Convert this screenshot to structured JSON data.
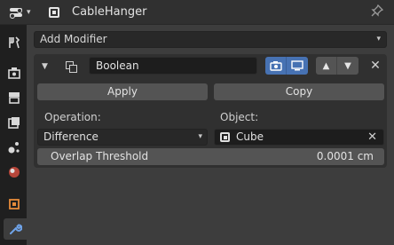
{
  "header": {
    "editor_type_icon": "properties-editor-icon",
    "object_icon": "object-icon",
    "object_name": "CableHanger",
    "pin_icon": "pin-icon"
  },
  "tabs": [
    {
      "icon": "tool-icon",
      "active": false
    },
    {
      "icon": "render-icon",
      "active": false
    },
    {
      "icon": "output-icon",
      "active": false
    },
    {
      "icon": "view-layer-icon",
      "active": false
    },
    {
      "icon": "scene-icon",
      "active": false
    },
    {
      "icon": "world-icon",
      "active": false
    },
    {
      "icon": "object-icon",
      "active": false
    },
    {
      "icon": "modifier-wrench-icon",
      "active": true
    }
  ],
  "add_modifier": {
    "label": "Add Modifier"
  },
  "modifier": {
    "name": "Boolean",
    "apply_label": "Apply",
    "copy_label": "Copy",
    "operation_label": "Operation:",
    "operation_value": "Difference",
    "object_label": "Object:",
    "object_value": "Cube",
    "overlap_label": "Overlap Threshold",
    "overlap_value": "0.0001 cm"
  },
  "colors": {
    "accent": "#4772b3",
    "background": "#3d3d3d",
    "panel": "#303030"
  }
}
